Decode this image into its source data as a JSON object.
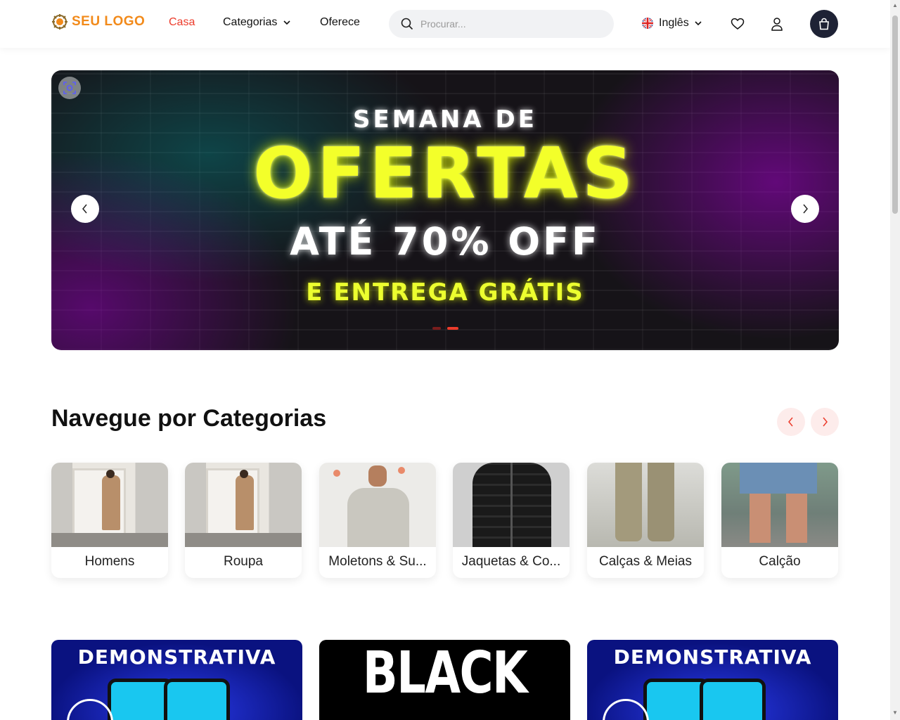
{
  "header": {
    "logo_text": "SEU LOGO",
    "nav": {
      "home": "Casa",
      "categories": "Categorias",
      "offers": "Oferece"
    },
    "search_placeholder": "Procurar...",
    "language": "Inglês",
    "icons": [
      "search-icon",
      "uk-flag-icon",
      "chevron-down-icon",
      "heart-icon",
      "user-icon",
      "shopping-bag-icon"
    ]
  },
  "hero": {
    "line1": "SEMANA DE",
    "line2": "OFERTAS",
    "line3": "ATÉ 70% OFF",
    "line4": "E ENTREGA GRÁTIS",
    "slides_count": 2,
    "active_slide": 2
  },
  "categories": {
    "title": "Navegue por Categorias",
    "items": [
      {
        "label": "Homens"
      },
      {
        "label": "Roupa"
      },
      {
        "label": "Moletons & Su..."
      },
      {
        "label": "Jaquetas & Co..."
      },
      {
        "label": "Calças & Meias"
      },
      {
        "label": "Calção"
      }
    ]
  },
  "promos": [
    {
      "title": "DEMONSTRATIVA"
    },
    {
      "title": "BLACK"
    },
    {
      "title": "DEMONSTRATIVA"
    }
  ],
  "colors": {
    "accent": "#ec3b2b",
    "logo": "#f28a1a",
    "cart_bg": "#1e2235",
    "neon_yellow": "#f3ff2a"
  }
}
